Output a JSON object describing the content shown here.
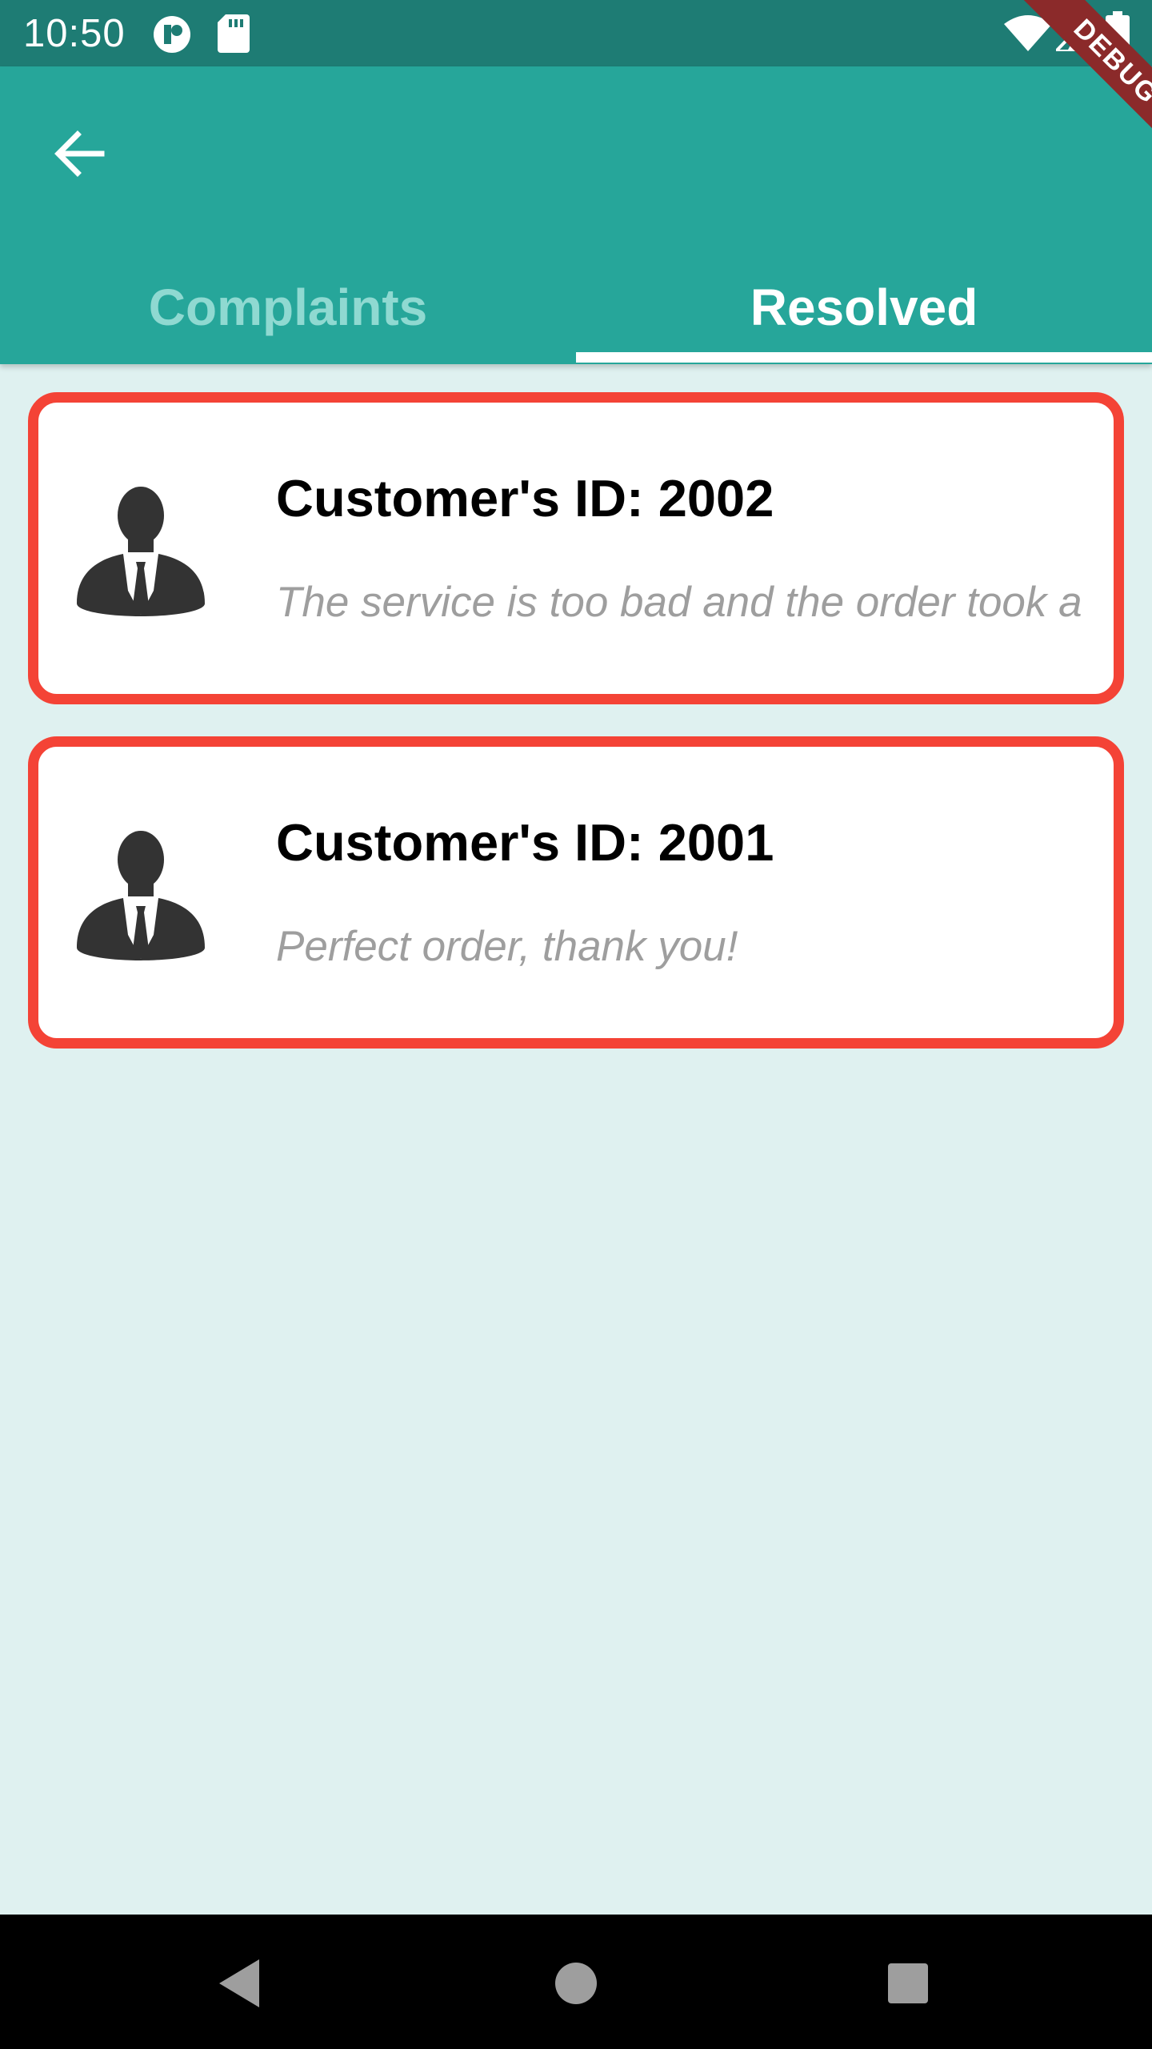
{
  "status_bar": {
    "time": "10:50",
    "icons": [
      "app-notification-icon",
      "sd-card-icon",
      "wifi-icon",
      "signal-icon",
      "battery-icon"
    ]
  },
  "debug_banner": {
    "label": "DEBUG"
  },
  "app_bar": {
    "back_icon": "arrow-back-icon",
    "tabs": [
      {
        "label": "Complaints",
        "selected": false
      },
      {
        "label": "Resolved",
        "selected": true
      }
    ]
  },
  "colors": {
    "status_bar": "#1E7C74",
    "app_bar": "#26A69A",
    "background": "#DFF1F0",
    "card_border": "#F44336",
    "inactive_tab": "#8FD9D1"
  },
  "cards": [
    {
      "title": "Customer's ID: 2002",
      "message": "The service is too bad and the order took a",
      "icon": "customer-avatar-icon"
    },
    {
      "title": "Customer's ID: 2001",
      "message": "Perfect order, thank you!",
      "icon": "customer-avatar-icon"
    }
  ],
  "nav_bar": {
    "buttons": [
      "back-triangle-icon",
      "home-circle-icon",
      "recents-square-icon"
    ]
  }
}
